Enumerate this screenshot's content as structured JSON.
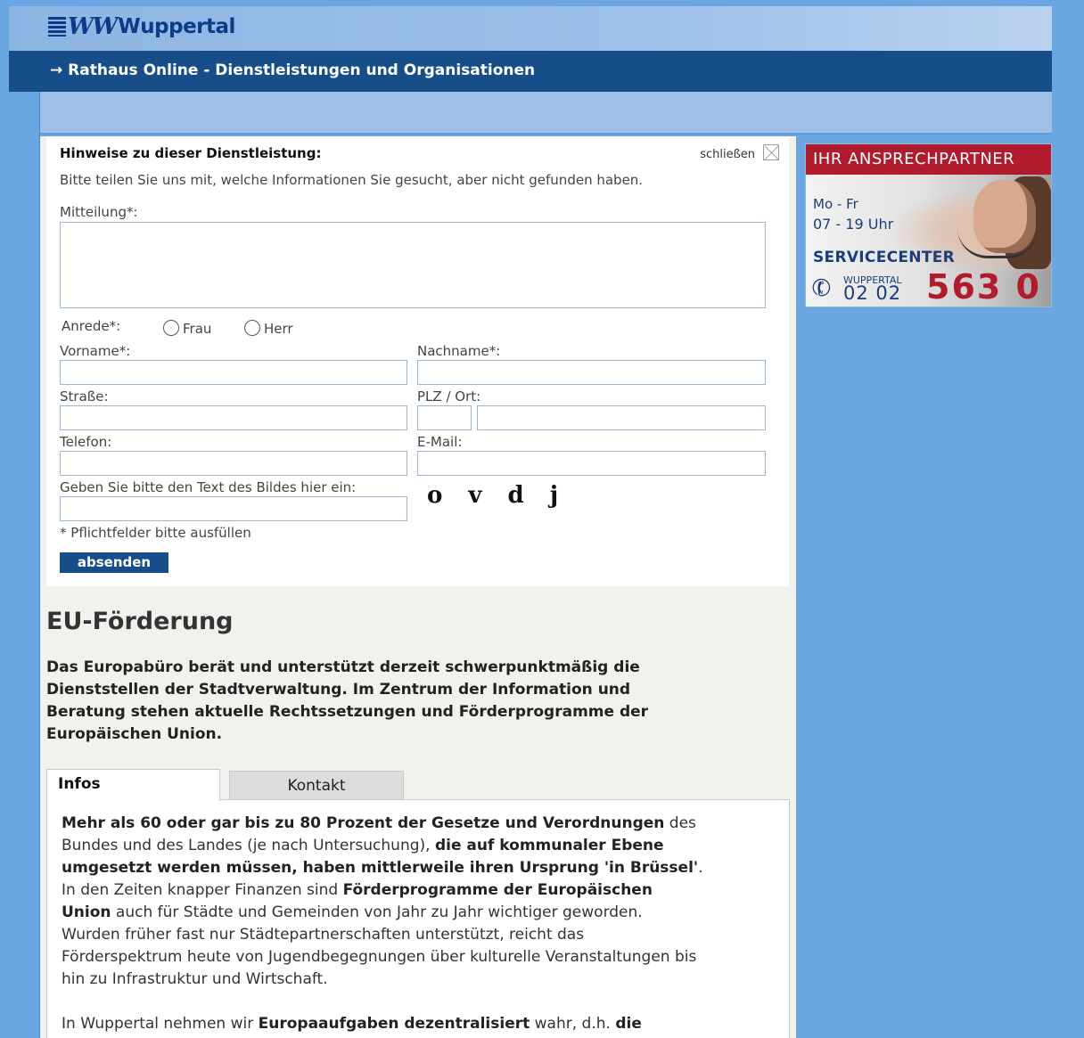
{
  "header": {
    "logo_text": "Wuppertal",
    "logo_mark": "W",
    "nav_title": "→ Rathaus Online - Dienstleistungen und Organisationen"
  },
  "feedback_form": {
    "title": "Hinweise zu dieser Dienstleistung:",
    "close_label": "schließen",
    "intro": "Bitte teilen Sie uns mit, welche Informationen Sie gesucht, aber nicht gefunden haben.",
    "message_label": "Mitteilung*:",
    "salutation_label": "Anrede*:",
    "salutation_options": [
      "Frau",
      "Herr"
    ],
    "firstname_label": "Vorname*:",
    "lastname_label": "Nachname*:",
    "street_label": "Straße:",
    "zip_city_label": "PLZ / Ort:",
    "phone_label": "Telefon:",
    "email_label": "E-Mail:",
    "captcha_label": "Geben Sie bitte den Text des Bildes hier ein:",
    "captcha_text": "o v d j",
    "required_note": "* Pflichtfelder bitte ausfüllen",
    "submit_label": "absenden"
  },
  "content": {
    "title": "EU-Förderung",
    "intro": "Das Europabüro berät und unterstützt derzeit schwerpunktmäßig die Dienststellen der Stadtverwaltung. Im Zentrum der Information und Beratung stehen aktuelle Rechtssetzungen und Förderprogramme der Europäischen Union.",
    "tabs": [
      {
        "label": "Infos",
        "active": true
      },
      {
        "label": "Kontakt",
        "active": false
      }
    ],
    "p1_b1": "Mehr als 60 oder gar bis zu 80 Prozent der Gesetze und Verordnungen",
    "p1_n1": " des Bundes und des Landes (je nach Untersuchung), ",
    "p1_b2": "die auf kommunaler Ebene umgesetzt werden müssen, haben mittlerweile ihren Ursprung 'in Brüssel'",
    "p1_n2": ".",
    "p2_n1": "In den Zeiten knapper Finanzen sind ",
    "p2_b1": "Förderprogramme der Europäischen Union",
    "p2_n2": " auch für Städte und Gemeinden von Jahr zu Jahr wichtiger geworden. Wurden früher fast nur Städtepartnerschaften unterstützt, reicht das Förderspektrum heute von Jugendbegegnungen über kulturelle Veranstaltungen bis hin zu Infrastruktur und Wirtschaft.",
    "p3_n1": "In Wuppertal nehmen wir ",
    "p3_b1": "Europaaufgaben dezentralisiert",
    "p3_n2": " wahr, d.h. ",
    "p3_b2": "die"
  },
  "sidebar": {
    "heading": "IHR ANSPRECHPARTNER",
    "days": "Mo - Fr",
    "hours": "07 - 19 Uhr",
    "label": "SERVICECENTER",
    "city": "WUPPERTAL",
    "area_code": "02 02",
    "number": "563 0"
  }
}
